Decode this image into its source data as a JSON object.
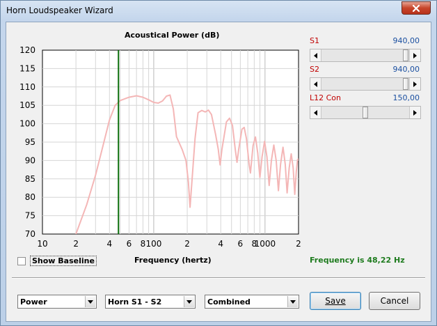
{
  "window": {
    "title": "Horn Loudspeaker Wizard"
  },
  "sliders": [
    {
      "label": "S1",
      "value": "940,00",
      "position": 1.0
    },
    {
      "label": "S2",
      "value": "940,00",
      "position": 1.0
    },
    {
      "label": "L12  Con",
      "value": "150,00",
      "position": 0.5
    }
  ],
  "show_baseline": {
    "label": "Show Baseline",
    "checked": false
  },
  "frequency_readout": "Frequency is 48,22 Hz",
  "combos": {
    "quantity": "Power",
    "element": "Horn S1 - S2",
    "mode": "Combined"
  },
  "buttons": {
    "save": "Save",
    "cancel": "Cancel"
  },
  "colors": {
    "curve": "#f4b6b6",
    "marker": "#0a6e0a",
    "readout": "#1e7b1e",
    "slider_label": "#c00000",
    "slider_value": "#1a4fa0"
  },
  "chart_data": {
    "type": "line",
    "title": "Acoustical Power (dB)",
    "xlabel": "Frequency (hertz)",
    "ylabel": "",
    "xscale": "log",
    "xlim": [
      10,
      2000
    ],
    "ylim": [
      70,
      120
    ],
    "y_ticks": [
      120,
      115,
      110,
      105,
      100,
      95,
      90,
      85,
      80,
      75,
      70
    ],
    "x_ticks": [
      {
        "value": 10,
        "label": "10"
      },
      {
        "value": 20,
        "label": "2"
      },
      {
        "value": 40,
        "label": "4"
      },
      {
        "value": 60,
        "label": "6"
      },
      {
        "value": 80,
        "label": "8"
      },
      {
        "value": 100,
        "label": "100"
      },
      {
        "value": 200,
        "label": "2"
      },
      {
        "value": 400,
        "label": "4"
      },
      {
        "value": 600,
        "label": "6"
      },
      {
        "value": 800,
        "label": "8"
      },
      {
        "value": 1000,
        "label": "1000"
      },
      {
        "value": 2000,
        "label": "2"
      }
    ],
    "grid": true,
    "marker_frequency": 48.22,
    "series": [
      {
        "values": [
          [
            20,
            70
          ],
          [
            25,
            78
          ],
          [
            30,
            86
          ],
          [
            35,
            94
          ],
          [
            40,
            101
          ],
          [
            45,
            105
          ],
          [
            50,
            106.3
          ],
          [
            60,
            107.2
          ],
          [
            70,
            107.6
          ],
          [
            80,
            107.2
          ],
          [
            90,
            106.5
          ],
          [
            100,
            105.8
          ],
          [
            110,
            105.6
          ],
          [
            120,
            106.2
          ],
          [
            130,
            107.5
          ],
          [
            140,
            107.8
          ],
          [
            150,
            104
          ],
          [
            160,
            96.5
          ],
          [
            180,
            93
          ],
          [
            195,
            90
          ],
          [
            205,
            84
          ],
          [
            212,
            77.3
          ],
          [
            220,
            84
          ],
          [
            235,
            96
          ],
          [
            250,
            103
          ],
          [
            270,
            103.6
          ],
          [
            290,
            103.2
          ],
          [
            310,
            103.7
          ],
          [
            330,
            102.5
          ],
          [
            360,
            97
          ],
          [
            380,
            93
          ],
          [
            395,
            88.8
          ],
          [
            410,
            93
          ],
          [
            450,
            100.5
          ],
          [
            480,
            101.5
          ],
          [
            510,
            99.5
          ],
          [
            540,
            93
          ],
          [
            560,
            89.5
          ],
          [
            580,
            93
          ],
          [
            620,
            98.5
          ],
          [
            650,
            99
          ],
          [
            680,
            96
          ],
          [
            720,
            89
          ],
          [
            740,
            86.6
          ],
          [
            780,
            94
          ],
          [
            820,
            96.4
          ],
          [
            860,
            92
          ],
          [
            900,
            85.4
          ],
          [
            940,
            91
          ],
          [
            990,
            95.2
          ],
          [
            1040,
            91
          ],
          [
            1090,
            83.2
          ],
          [
            1140,
            90
          ],
          [
            1200,
            94.2
          ],
          [
            1260,
            90
          ],
          [
            1320,
            81.8
          ],
          [
            1380,
            89
          ],
          [
            1450,
            93.6
          ],
          [
            1520,
            89
          ],
          [
            1580,
            81.2
          ],
          [
            1650,
            88
          ],
          [
            1720,
            91.8
          ],
          [
            1790,
            88
          ],
          [
            1850,
            80.8
          ],
          [
            1910,
            87
          ],
          [
            1960,
            90.2
          ],
          [
            2000,
            90.5
          ]
        ]
      }
    ]
  }
}
